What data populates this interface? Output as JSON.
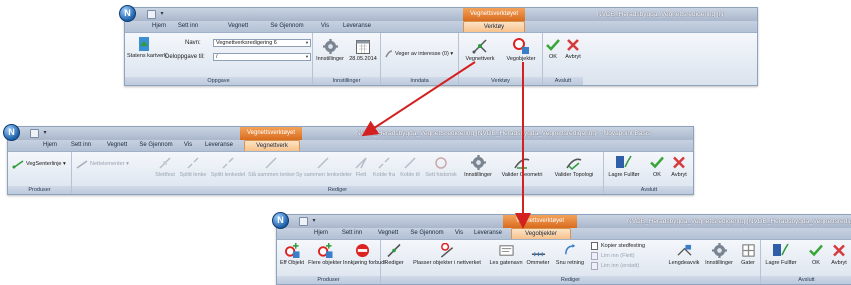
{
  "screens": {
    "top": {
      "orb": "N",
      "context_tab": "Vegnettsverktøyet",
      "title": "NVDB_Heradsbygda_Vegnettsredigering [N",
      "tabs": [
        "Hjem",
        "Sett inn",
        "Vegnett",
        "Se Gjennom",
        "Vis",
        "Leveranse",
        "Verktøy"
      ],
      "active_tab": "Verktøy",
      "oppgave": {
        "statens_kartverk": "Statens kartverk",
        "navn_label": "Navn:",
        "navn_value": "Vegnettverksredigering 6",
        "deloppgave_label": "Deloppgave til:",
        "deloppgave_value": "/",
        "label": "Oppgave"
      },
      "innstillinger_group": {
        "innstillinger": "Innstillinger",
        "date": "28.05.2014",
        "label": "Innstillinger"
      },
      "inndata_group": {
        "veger": "Veger av interesse (0)",
        "label": "Inndata"
      },
      "verktoy_group": {
        "vegnettverk": "Vegnettverk",
        "vegobjekter": "Vegobjekter",
        "label": "Verktøy"
      },
      "avslutt_group": {
        "ok": "OK",
        "avbryt": "Avbryt",
        "label": "Avslutt"
      }
    },
    "middle": {
      "orb": "N",
      "context_tab": "Vegnettsverktøyet",
      "title": "NVDB_Heradsbygda_Vegnettsredigering [NVDB_Heradsbygda_Vegnettsredigering] - Novapoint Basis",
      "tabs": [
        "Hjem",
        "Sett inn",
        "Vegnett",
        "Se Gjennom",
        "Vis",
        "Leveranse",
        "Vegnettverk"
      ],
      "active_tab": "Vegnettverk",
      "produser": {
        "vegsenterlinje": "VegSenterlinje",
        "label": "Produser"
      },
      "rediger": {
        "nettelementer": "Nettelementer",
        "buttons": [
          "Slettfest",
          "Splitt lenke",
          "Splitt lenkedel",
          "Slå sammen lenker",
          "Sy sammen lenkedeler",
          "Flett",
          "Koble fra",
          "Koble til",
          "Sett historisk",
          "Innstillinger",
          "Valider Geometri",
          "Valider Topologi"
        ],
        "label": "Rediger"
      },
      "avslutt": {
        "lagre": "Lagre Fullfør",
        "ok": "OK",
        "avbryt": "Avbryt",
        "label": "Avslutt"
      }
    },
    "bottom": {
      "orb": "N",
      "context_tab": "Vegnettsverktøyet",
      "title": "NVDB_Heradsbygda_Vegnettsredigering [NVDB_Heradsbygda_Vegnettsredigering] -",
      "tabs": [
        "Hjem",
        "Sett inn",
        "Vegnett",
        "Se Gjennom",
        "Vis",
        "Leveranse",
        "Vegobjekter"
      ],
      "active_tab": "Vegobjekter",
      "produser": {
        "eff_objekt": "Eff Objekt",
        "flere_objekter": "Flere objekter",
        "innkjoring": "Innkjøring forbudt",
        "label": "Produser"
      },
      "rediger": {
        "rediger": "Rediger",
        "plasser": "Plasser objekter i nettverket",
        "les_gatenavn": "Les gatenavn",
        "ommeter": "Ommeter",
        "snu_retning": "Snu retning",
        "kopier": "Kopier stedfesting",
        "lim_inn_flett": "Lim inn (Flett)",
        "lim_inn_erstatt": "Lim inn (erstatt)",
        "lengdeavvik": "Lengdeavvik",
        "innstillinger": "Innstillinger",
        "gater": "Gater",
        "label": "Rediger"
      },
      "avslutt": {
        "lagre": "Lagre Fullfør",
        "ok": "OK",
        "avbryt": "Avbryt",
        "label": "Avslutt"
      }
    }
  },
  "colors": {
    "arrow": "#d42020",
    "ok_green": "#3aa63a",
    "cancel_red": "#d63a3a",
    "context_orange": "#e07a2a"
  }
}
